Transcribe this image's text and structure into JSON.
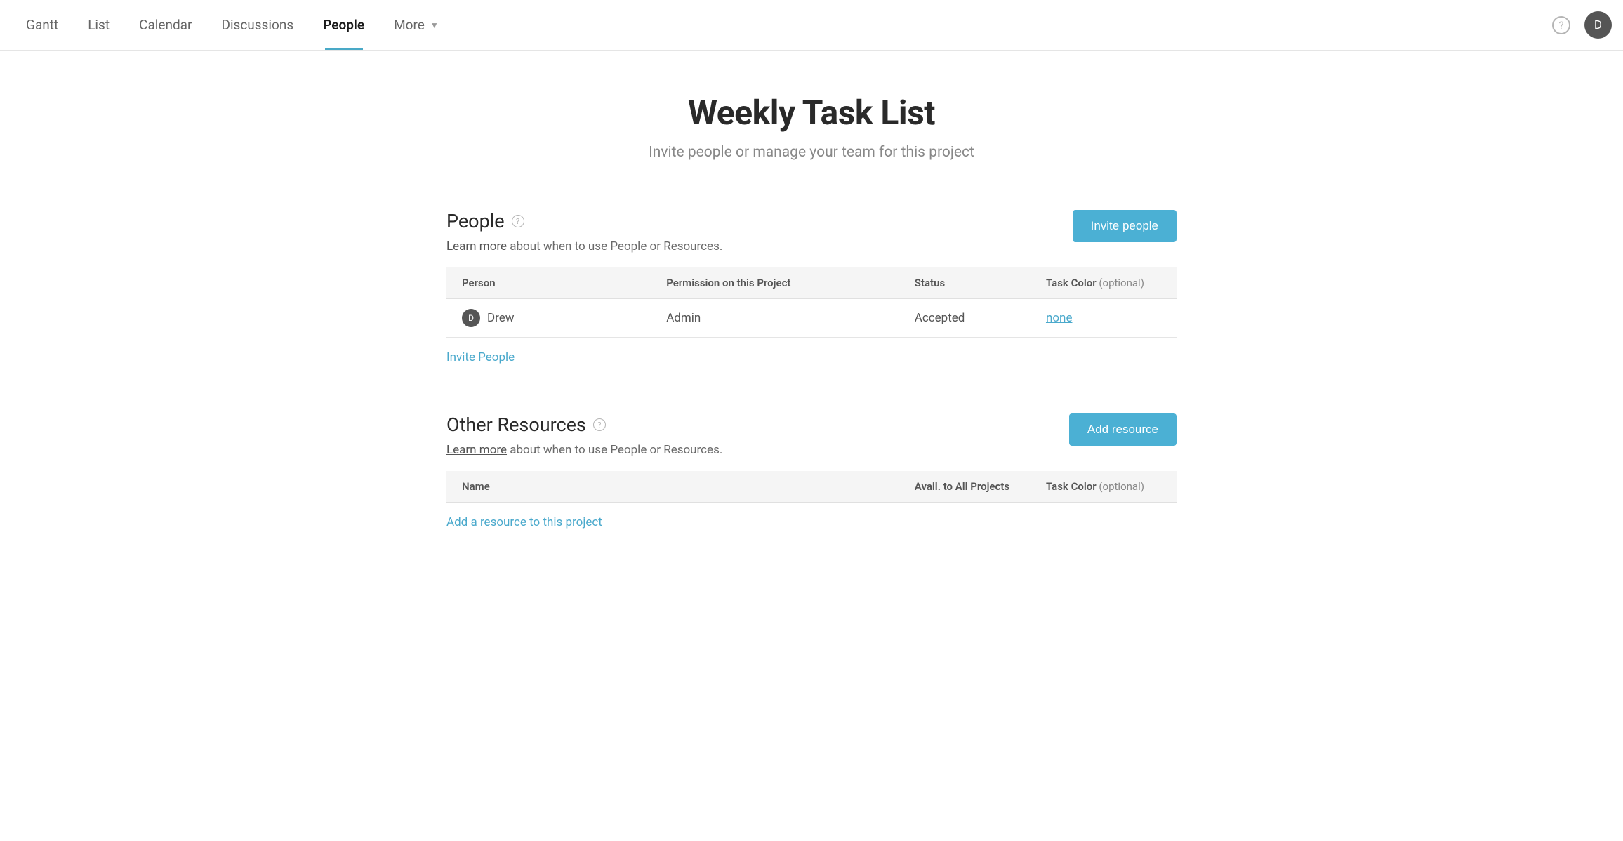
{
  "nav": {
    "tabs": [
      {
        "label": "Gantt",
        "active": false
      },
      {
        "label": "List",
        "active": false
      },
      {
        "label": "Calendar",
        "active": false
      },
      {
        "label": "Discussions",
        "active": false
      },
      {
        "label": "People",
        "active": true
      },
      {
        "label": "More",
        "active": false,
        "dropdown": true
      }
    ],
    "user_initial": "D"
  },
  "page": {
    "title": "Weekly Task List",
    "subtitle": "Invite people or manage your team for this project"
  },
  "people_section": {
    "title": "People",
    "learn_more_label": "Learn more",
    "desc_suffix": " about when to use People or Resources.",
    "invite_button": "Invite people",
    "columns": {
      "person": "Person",
      "permission": "Permission on this Project",
      "status": "Status",
      "task_color": "Task Color",
      "task_color_optional": "(optional)"
    },
    "rows": [
      {
        "avatar_initial": "D",
        "name": "Drew",
        "permission": "Admin",
        "status": "Accepted",
        "task_color": "none"
      }
    ],
    "footer_link": "Invite People"
  },
  "resources_section": {
    "title": "Other Resources",
    "learn_more_label": "Learn more",
    "desc_suffix": " about when to use People or Resources.",
    "add_button": "Add resource",
    "columns": {
      "name": "Name",
      "avail": "Avail. to All Projects",
      "task_color": "Task Color",
      "task_color_optional": "(optional)"
    },
    "footer_link": "Add a resource to this project"
  }
}
